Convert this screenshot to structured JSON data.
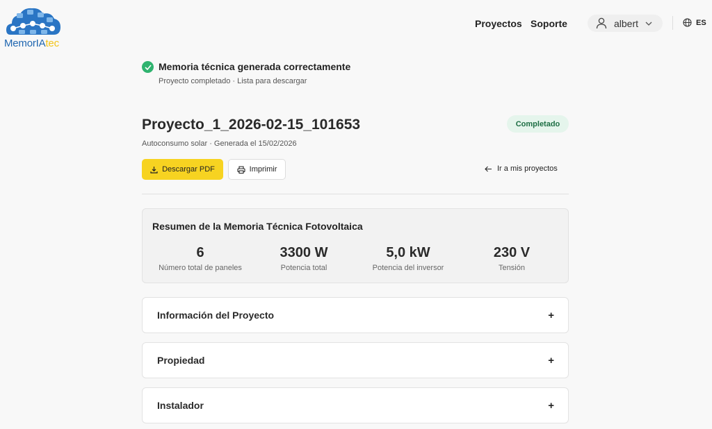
{
  "header": {
    "logo_part1": "MemorIA",
    "logo_part2": "tec",
    "nav_projects": "Proyectos",
    "nav_support": "Soporte",
    "username": "albert",
    "language": "ES"
  },
  "success": {
    "title": "Memoria técnica generada correctamente",
    "subtitle": "Proyecto completado · Lista para descargar"
  },
  "project": {
    "title": "Proyecto_1_2026-02-15_101653",
    "status": "Completado",
    "meta": "Autoconsumo solar  ·  Generada el 15/02/2026"
  },
  "actions": {
    "download": "Descargar PDF",
    "print": "Imprimir",
    "back": "Ir a mis proyectos"
  },
  "summary": {
    "title": "Resumen de la Memoria Técnica Fotovoltaica",
    "stats": [
      {
        "value": "6",
        "label": "Número total de paneles"
      },
      {
        "value": "3300 W",
        "label": "Potencia total"
      },
      {
        "value": "5,0 kW",
        "label": "Potencia del inversor"
      },
      {
        "value": "230 V",
        "label": "Tensión"
      }
    ]
  },
  "sections": [
    {
      "title": "Información del Proyecto",
      "toggle": "+"
    },
    {
      "title": "Propiedad",
      "toggle": "+"
    },
    {
      "title": "Instalador",
      "toggle": "+"
    }
  ],
  "colors": {
    "accent_yellow": "#f7d321",
    "success_green": "#2fb36f",
    "logo_blue": "#1f66b0"
  }
}
